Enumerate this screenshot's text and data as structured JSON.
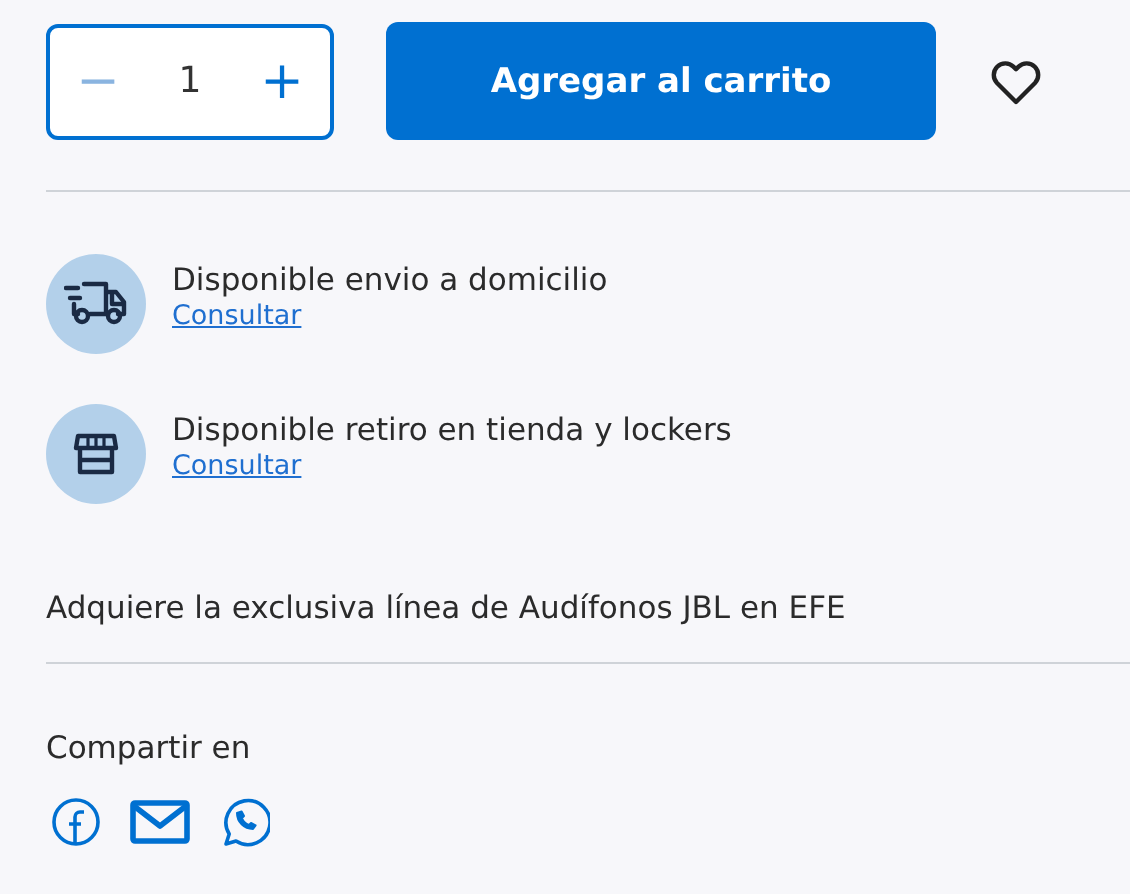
{
  "quantity": {
    "minus": "−",
    "value": "1",
    "plus": "+",
    "minus_disabled": true
  },
  "add_to_cart": "Agregar al carrito",
  "availability": [
    {
      "kind": "delivery",
      "text": "Disponible envio a domicilio",
      "link": "Consultar"
    },
    {
      "kind": "store",
      "text": "Disponible retiro en tienda y lockers",
      "link": "Consultar"
    }
  ],
  "promo": "Adquiere la exclusiva línea de Audífonos JBL en EFE",
  "share": {
    "label": "Compartir en",
    "networks": [
      {
        "kind": "facebook"
      },
      {
        "kind": "email"
      },
      {
        "kind": "whatsapp"
      }
    ]
  }
}
